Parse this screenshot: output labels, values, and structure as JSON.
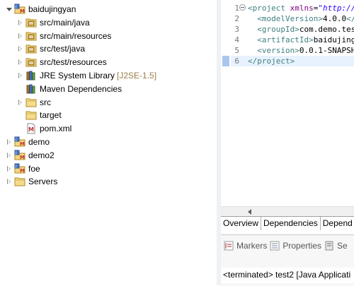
{
  "explorer": {
    "items": [
      {
        "label": "baidujingyan",
        "decoration": "",
        "arrow": "expanded",
        "icon": "maven-project-icon"
      },
      {
        "label": "src/main/java",
        "decoration": "",
        "arrow": "collapsed",
        "icon": "source-folder-icon"
      },
      {
        "label": "src/main/resources",
        "decoration": "",
        "arrow": "collapsed",
        "icon": "source-folder-icon"
      },
      {
        "label": "src/test/java",
        "decoration": "",
        "arrow": "collapsed",
        "icon": "source-folder-icon"
      },
      {
        "label": "src/test/resources",
        "decoration": "",
        "arrow": "collapsed",
        "icon": "source-folder-icon"
      },
      {
        "label": "JRE System Library",
        "decoration": "[J2SE-1.5]",
        "arrow": "collapsed",
        "icon": "library-icon"
      },
      {
        "label": "Maven Dependencies",
        "decoration": "",
        "arrow": "none",
        "icon": "library-icon"
      },
      {
        "label": "src",
        "decoration": "",
        "arrow": "collapsed",
        "icon": "folder-icon"
      },
      {
        "label": "target",
        "decoration": "",
        "arrow": "none",
        "icon": "folder-icon"
      },
      {
        "label": "pom.xml",
        "decoration": "",
        "arrow": "none",
        "icon": "xml-file-icon"
      },
      {
        "label": "demo",
        "decoration": "",
        "arrow": "collapsed",
        "icon": "maven-project-icon"
      },
      {
        "label": "demo2",
        "decoration": "",
        "arrow": "collapsed",
        "icon": "maven-project-icon"
      },
      {
        "label": "foe",
        "decoration": "",
        "arrow": "collapsed",
        "icon": "maven-project-icon"
      },
      {
        "label": "Servers",
        "decoration": "",
        "arrow": "collapsed",
        "icon": "folder-icon"
      }
    ]
  },
  "editor": {
    "lines": [
      {
        "n": "1",
        "parts": [
          {
            "c": "tag",
            "t": "<project "
          },
          {
            "c": "attr",
            "t": "xmlns"
          },
          {
            "c": "txt",
            "t": "="
          },
          {
            "c": "str",
            "t": "\"http://"
          }
        ]
      },
      {
        "n": "2",
        "parts": [
          {
            "c": "tag",
            "t": "  <modelVersion>"
          },
          {
            "c": "txt",
            "t": "4.0.0"
          },
          {
            "c": "tag",
            "t": "</"
          }
        ]
      },
      {
        "n": "3",
        "parts": [
          {
            "c": "tag",
            "t": "  <groupId>"
          },
          {
            "c": "txt",
            "t": "com.demo.tes"
          }
        ]
      },
      {
        "n": "4",
        "parts": [
          {
            "c": "tag",
            "t": "  <artifactId>"
          },
          {
            "c": "txt",
            "t": "baidujing"
          }
        ]
      },
      {
        "n": "5",
        "parts": [
          {
            "c": "tag",
            "t": "  <version>"
          },
          {
            "c": "txt",
            "t": "0.0.1-SNAPSH"
          }
        ]
      },
      {
        "n": "6",
        "parts": [
          {
            "c": "tag",
            "t": "</project>"
          }
        ]
      }
    ],
    "tabs": [
      "Overview",
      "Dependencies",
      "Depend"
    ]
  },
  "bottom_view": {
    "tabs": [
      {
        "label": "Markers",
        "icon": "markers-icon"
      },
      {
        "label": "Properties",
        "icon": "properties-icon"
      },
      {
        "label": "Se",
        "icon": "servers-icon"
      }
    ],
    "console_status": "<terminated> test2 [Java Applicati"
  },
  "colors": {
    "xml_tag": "#3f7f7f",
    "xml_attr": "#7f007f",
    "xml_string": "#2a00ff",
    "decoration": "#9a7d4a"
  }
}
